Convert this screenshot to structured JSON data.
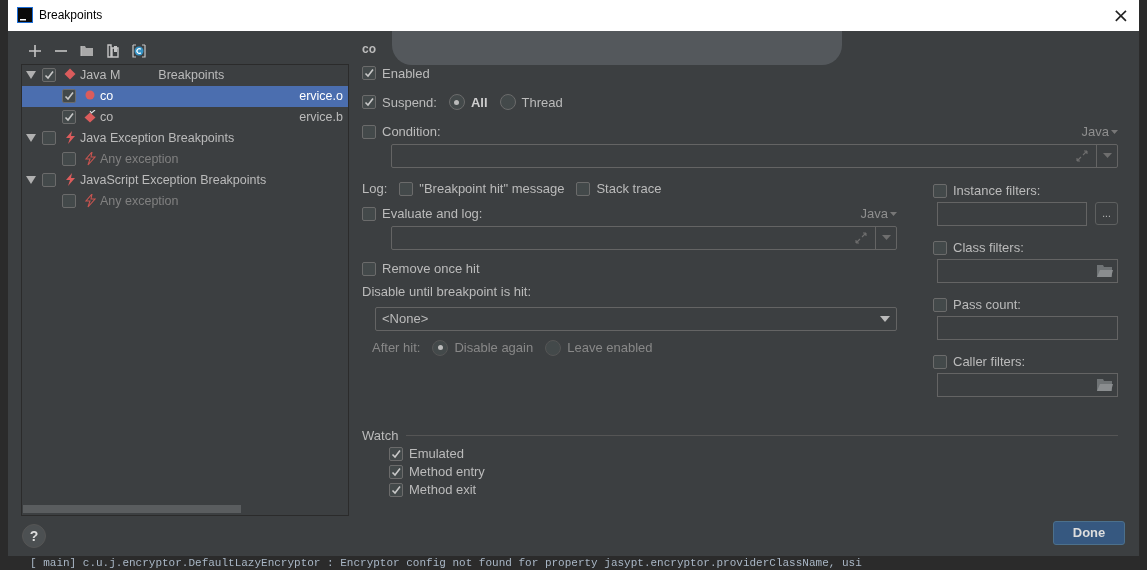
{
  "window": {
    "title": "Breakpoints",
    "close": "×"
  },
  "toolbar": [
    {
      "kind": "add"
    },
    {
      "kind": "remove"
    },
    {
      "kind": "group"
    },
    {
      "kind": "group_class"
    },
    {
      "kind": "class"
    }
  ],
  "tree": [
    {
      "kind": "method_group",
      "label": "Java M",
      "label_tail": "Breakpoints",
      "checked": true,
      "expanded": true,
      "selected": false,
      "children": [
        {
          "kind": "method",
          "label": "co",
          "label_tail": "ervice.o",
          "checked": true,
          "selected": true
        },
        {
          "kind": "method_entry",
          "label": "co",
          "label_tail": "ervice.b",
          "checked": true,
          "selected": false
        }
      ]
    },
    {
      "kind": "exception_group",
      "label": "Java Exception Breakpoints",
      "checked": false,
      "expanded": true,
      "selected": false,
      "children": [
        {
          "kind": "exception",
          "label": "Any exception",
          "checked": false,
          "selected": false,
          "disabled": true
        }
      ]
    },
    {
      "kind": "exception_group",
      "label": "JavaScript Exception Breakpoints",
      "checked": false,
      "expanded": true,
      "selected": false,
      "children": [
        {
          "kind": "exception",
          "label": "Any exception",
          "checked": false,
          "selected": false,
          "disabled": true
        }
      ]
    }
  ],
  "details": {
    "heading": "co",
    "enabled": {
      "label": "Enabled",
      "checked": true
    },
    "suspend": {
      "label": "Suspend:",
      "checked": true,
      "options": [
        {
          "label": "All",
          "selected": true
        },
        {
          "label": "Thread",
          "selected": false
        }
      ]
    },
    "condition": {
      "label": "Condition:",
      "checked": false,
      "language": "Java"
    },
    "log": {
      "label": "Log:",
      "options": [
        {
          "label": "\"Breakpoint hit\" message",
          "checked": false
        },
        {
          "label": "Stack trace",
          "checked": false
        }
      ]
    },
    "evaluate": {
      "label": "Evaluate and log:",
      "checked": false,
      "language": "Java"
    },
    "remove_once_hit": {
      "label": "Remove once hit",
      "checked": false
    },
    "disable_until": {
      "label": "Disable until breakpoint is hit:",
      "value": "<None>"
    },
    "after_hit": {
      "label": "After hit:",
      "disabled": true,
      "options": [
        {
          "label": "Disable again",
          "selected": true
        },
        {
          "label": "Leave enabled",
          "selected": false
        }
      ]
    },
    "filters": [
      {
        "label": "Instance filters:",
        "checked": false,
        "kind": "more",
        "button": "..."
      },
      {
        "label": "Class filters:",
        "checked": false,
        "kind": "folder"
      },
      {
        "label": "Pass count:",
        "checked": false,
        "kind": "plain"
      },
      {
        "label": "Caller filters:",
        "checked": false,
        "kind": "folder"
      }
    ],
    "watch": {
      "label": "Watch",
      "items": [
        {
          "label": "Emulated",
          "checked": true
        },
        {
          "label": "Method entry",
          "checked": true
        },
        {
          "label": "Method exit",
          "checked": true
        }
      ]
    }
  },
  "help_button": "?",
  "done_button": "Done",
  "background_log_line": "[          main] c.u.j.encryptor.DefaultLazyEncryptor      : Encryptor config not found for property jasypt.encryptor.providerClassName, usi"
}
